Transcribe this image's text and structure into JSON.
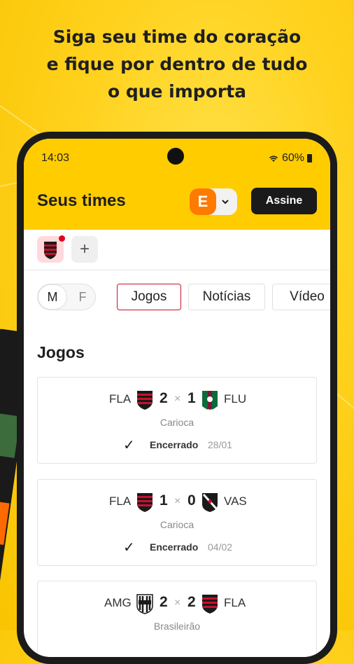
{
  "headline": [
    "Siga seu time do coração",
    "e fique por dentro de tudo",
    "o que importa"
  ],
  "status_bar": {
    "time": "14:03",
    "battery": "60%"
  },
  "header": {
    "title": "Seus times",
    "edition_letter": "E",
    "subscribe_label": "Assine"
  },
  "gender_toggle": {
    "male": "M",
    "female": "F"
  },
  "tabs": [
    {
      "label": "Jogos",
      "active": true
    },
    {
      "label": "Notícias",
      "active": false
    },
    {
      "label": "Vídeo",
      "active": false
    }
  ],
  "section_title": "Jogos",
  "matches": [
    {
      "home": "FLA",
      "home_score": "2",
      "away_score": "1",
      "away": "FLU",
      "competition": "Carioca",
      "status": "Encerrado",
      "date": "28/01"
    },
    {
      "home": "FLA",
      "home_score": "1",
      "away_score": "0",
      "away": "VAS",
      "competition": "Carioca",
      "status": "Encerrado",
      "date": "04/02"
    },
    {
      "home": "AMG",
      "home_score": "2",
      "away_score": "2",
      "away": "FLA",
      "competition": "Brasileirão",
      "status": "",
      "date": ""
    }
  ],
  "separator": "×",
  "colors": {
    "brand_yellow": "#ffcc00",
    "edition_orange": "#ff7a00",
    "active_tab_border": "#c8102e",
    "flamengo_red": "#c8102e"
  }
}
